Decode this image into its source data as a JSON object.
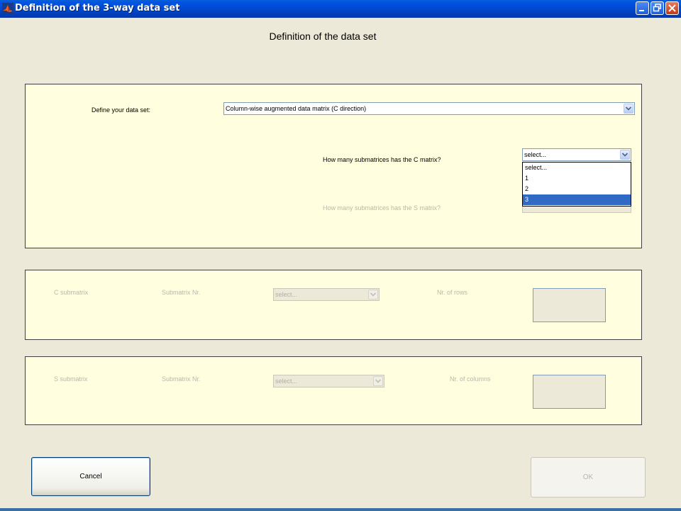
{
  "window": {
    "title": "Definition of the 3-way data set"
  },
  "heading": "Definition of the data set",
  "definition_panel": {
    "define_label": "Define your data set:",
    "define_value": "Column-wise augmented data matrix (C direction)",
    "c_question": "How many submatrices has the C matrix?",
    "c_select_value": "select...",
    "c_options": [
      "select...",
      "1",
      "2",
      "3"
    ],
    "c_highlighted": "3",
    "s_question": "How many submatrices has the S matrix?"
  },
  "c_panel": {
    "title": "C submatrix",
    "submatrix_label": "Submatrix Nr.",
    "select_value": "select...",
    "count_label": "Nr. of rows"
  },
  "s_panel": {
    "title": "S submatrix",
    "submatrix_label": "Submatrix Nr.",
    "select_value": "select...",
    "count_label": "Nr. of columns"
  },
  "buttons": {
    "cancel": "Cancel",
    "ok": "OK"
  },
  "colors": {
    "panel_bg": "#ffffe0",
    "window_bg": "#ece9d8",
    "titlebar": "#0054e3",
    "highlight": "#316ac5"
  },
  "icons": [
    "matlab-icon",
    "minimize-icon",
    "maximize-icon",
    "close-icon",
    "chevron-down-icon"
  ]
}
